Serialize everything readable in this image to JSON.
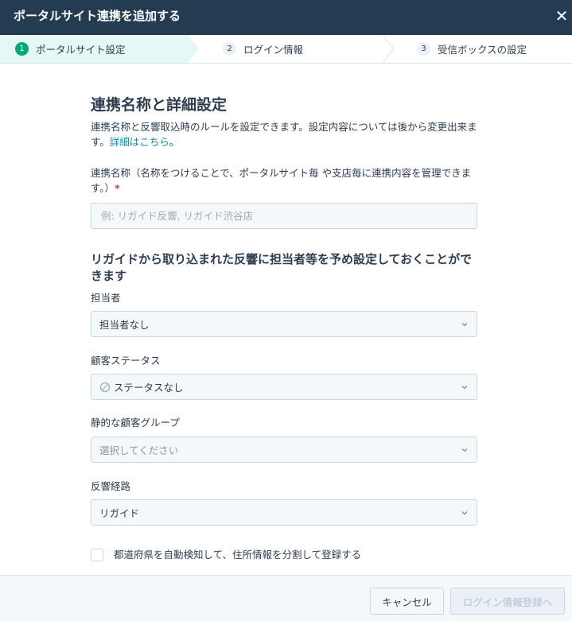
{
  "header": {
    "title": "ポータルサイト連携を追加する",
    "close_icon": "✕"
  },
  "stepper": [
    {
      "num": "1",
      "label": "ポータルサイト設定"
    },
    {
      "num": "2",
      "label": "ログイン情報"
    },
    {
      "num": "3",
      "label": "受信ボックスの設定"
    }
  ],
  "section": {
    "title": "連携名称と詳細設定",
    "desc": "連携名称と反響取込時のルールを設定できます。設定内容については後から変更出来ます。",
    "desc_link": "詳細はこちら",
    "desc_end": "。"
  },
  "name_field": {
    "label": "連携名称（名称をつけることで、ポータルサイト毎 や支店毎に連携内容を管理できます。）",
    "required_mark": "*",
    "placeholder": "例: リガイド反響, リガイド渋谷店"
  },
  "preset": {
    "title": "リガイドから取り込まれた反響に担当者等を予め設定しておくことができます"
  },
  "owner": {
    "label": "担当者",
    "value": "担当者なし"
  },
  "status": {
    "label": "顧客ステータス",
    "value": "ステータスなし"
  },
  "group": {
    "label": "静的な顧客グループ",
    "value": "選択してください"
  },
  "route": {
    "label": "反響経路",
    "value": "リガイド"
  },
  "auto_detect": {
    "label": "都道府県を自動検知して、住所情報を分割して登録する",
    "checked": false
  },
  "footer": {
    "cancel": "キャンセル",
    "next": "ログイン情報登録へ"
  },
  "colors": {
    "header_bg": "#233c52",
    "active_step": "#00a97a",
    "link": "#0091ae",
    "required": "#d9363e"
  }
}
